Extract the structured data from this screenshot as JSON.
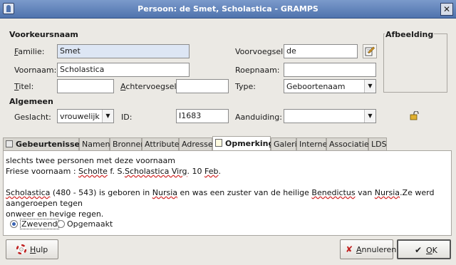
{
  "window": {
    "title": "Persoon: de Smet, Scholastica - GRAMPS",
    "close_glyph": "✕"
  },
  "preferred_name": {
    "heading": "Voorkeursnaam",
    "family_label": "Familie:",
    "family_value": "Smet",
    "prefix_label": "Voorvoegsel:",
    "prefix_value": "de",
    "given_label": "Voornaam:",
    "given_value": "Scholastica",
    "call_label": "Roepnaam:",
    "call_value": "",
    "title_label": "Titel:",
    "title_value": "",
    "suffix_label": "Achtervoegsel:",
    "suffix_value": "",
    "type_label": "Type:",
    "type_value": "Geboortenaam"
  },
  "image": {
    "heading": "Afbeelding"
  },
  "general": {
    "heading": "Algemeen",
    "gender_label": "Geslacht:",
    "gender_value": "vrouwelijk",
    "id_label": "ID:",
    "id_value": "I1683",
    "marker_label": "Aanduiding:",
    "marker_value": ""
  },
  "tabs": [
    "Gebeurtenissen",
    "Namen",
    "Bronnen",
    "Attributen",
    "Adressen",
    "Opmerking",
    "Galerij",
    "Internet",
    "Associaties",
    "LDS"
  ],
  "active_tab": "Opmerking",
  "note": {
    "line1": "slechts twee personen met deze voornaam",
    "line2_a": "Friese voornaam : ",
    "line2_b": "Scholte",
    "line2_c": " f. S.",
    "line2_d": "Scholastica Virg",
    "line2_e": ". 10 ",
    "line2_f": "Feb",
    "line2_g": ".",
    "line3_a": "Scholastica",
    "line3_b": " (480 - 543) is geboren in ",
    "line3_c": "Nursia",
    "line3_d": " en was een zuster van de heilige ",
    "line3_e": "Benedictus",
    "line3_f": " van ",
    "line3_g": "Nursia",
    "line3_h": ".Ze werd aangeroepen tegen",
    "line4": "onweer en hevige regen."
  },
  "format": {
    "flowed_label": "Zwevend",
    "preformatted_label": "Opgemaakt",
    "selected": "Zwevend"
  },
  "buttons": {
    "help": "Hulp",
    "cancel": "Annuleren",
    "ok": "OK"
  },
  "colors": {
    "titlebar": "#5b7fb8",
    "selection": "#dde6f4",
    "spell_error": "#d02020"
  }
}
